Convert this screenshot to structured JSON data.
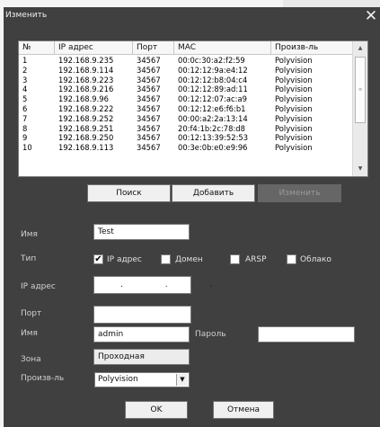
{
  "window": {
    "title": "Изменить",
    "close_glyph": "✕"
  },
  "list": {
    "columns": [
      "№",
      "IP адрес",
      "Порт",
      "MAC",
      "Произв-ль"
    ],
    "rows": [
      {
        "num": "1",
        "ip": "192.168.9.235",
        "port": "34567",
        "mac": "00:0c:30:a2:f2:59",
        "maker": "Polyvision"
      },
      {
        "num": "2",
        "ip": "192.168.9.114",
        "port": "34567",
        "mac": "00:12:12:9a:e4:12",
        "maker": "Polyvision"
      },
      {
        "num": "3",
        "ip": "192.168.9.223",
        "port": "34567",
        "mac": "00:12:12:b8:04:c4",
        "maker": "Polyvision"
      },
      {
        "num": "4",
        "ip": "192.168.9.216",
        "port": "34567",
        "mac": "00:12:12:89:ad:11",
        "maker": "Polyvision"
      },
      {
        "num": "5",
        "ip": "192.168.9.96",
        "port": "34567",
        "mac": "00:12:12:07:ac:a9",
        "maker": "Polyvision"
      },
      {
        "num": "6",
        "ip": "192.168.9.222",
        "port": "34567",
        "mac": "00:12:12:e6:f6:b1",
        "maker": "Polyvision"
      },
      {
        "num": "7",
        "ip": "192.168.9.252",
        "port": "34567",
        "mac": "00:00:a2:2a:13:14",
        "maker": "Polyvision"
      },
      {
        "num": "8",
        "ip": "192.168.9.251",
        "port": "34567",
        "mac": "20:f4:1b:2c:78:d8",
        "maker": "Polyvision"
      },
      {
        "num": "9",
        "ip": "192.168.9.250",
        "port": "34567",
        "mac": "00:12:13:39:52:53",
        "maker": "Polyvision"
      },
      {
        "num": "10",
        "ip": "192.168.9.113",
        "port": "34567",
        "mac": "00:3e:0b:e0:e9:96",
        "maker": "Polyvision"
      }
    ]
  },
  "actions": {
    "search": "Поиск",
    "add": "Добавить",
    "edit": "Изменить"
  },
  "form": {
    "name_label": "Имя",
    "name_value": "Test",
    "type_label": "Тип",
    "type_options": {
      "ip": {
        "label": "IP адрес",
        "checked": true
      },
      "domain": {
        "label": "Домен",
        "checked": false
      },
      "arsp": {
        "label": "ARSP",
        "checked": false
      },
      "cloud": {
        "label": "Облако",
        "checked": false
      }
    },
    "ip_label": "IP адрес",
    "ip_value": ". . .",
    "port_label": "Порт",
    "port_value": "",
    "user_label": "Имя",
    "user_value": "admin",
    "password_label": "Пароль",
    "password_value": "",
    "zone_label": "Зона",
    "zone_value": "Проходная",
    "maker_label": "Произв-ль",
    "maker_value": "Polyvision"
  },
  "footer": {
    "ok": "OK",
    "cancel": "Отмена"
  },
  "colors": {
    "window_bg": "#404040",
    "label_text": "#d0d0d0"
  }
}
